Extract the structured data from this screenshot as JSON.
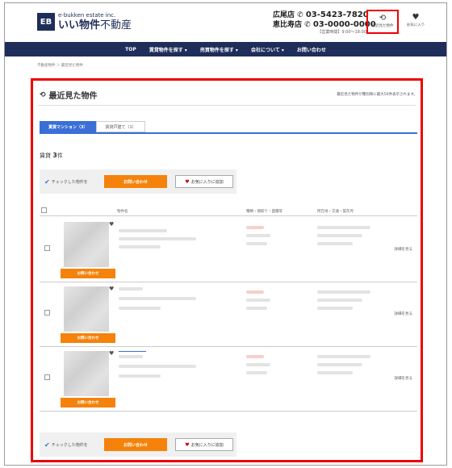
{
  "header": {
    "logo_mark": "EB",
    "logo_sub": "e-bukken estate inc.",
    "logo_main_bold": "いい物件",
    "logo_main_rest": "不動産",
    "contact": [
      {
        "office": "広尾店",
        "phone": "03-5423-7820"
      },
      {
        "office": "恵比寿店",
        "phone": "03-0000-0000"
      }
    ],
    "hours": "【営業時間】9:00～18:00",
    "recent_label": "最近見た物件",
    "favorites_label": "お気に入り"
  },
  "nav": {
    "items": [
      "TOP",
      "賃貸物件を探す ▾",
      "売買物件を探す ▾",
      "会社について ▾",
      "お問い合わせ"
    ]
  },
  "breadcrumb": "不動産物件 ＞ 最近見た物件",
  "main": {
    "title": "最近見た物件",
    "note": "最近見た物件が種別毎に最大50件表示されます。",
    "tabs": [
      {
        "label": "賃貸マンション（3）",
        "active": true
      },
      {
        "label": "賃貸戸建て（1）",
        "active": false
      }
    ],
    "count_prefix": "賃貸",
    "count_value": "3",
    "count_suffix": "件",
    "check_label": "チェックした物件を",
    "inquiry_button": "お問い合わせ",
    "favorite_button": "お気に入りに追加",
    "table_headers": [
      "物件名",
      "種類・間取り・面積等",
      "所在地・交通・築年月"
    ],
    "rows": [
      {
        "inquiry": "お問い合わせ",
        "detail": "詳細を見る"
      },
      {
        "inquiry": "お問い合わせ",
        "detail": "詳細を見る"
      },
      {
        "inquiry": "お問い合わせ",
        "detail": "詳細を見る"
      }
    ]
  },
  "icons": {
    "recent": "history-icon",
    "favorites": "heart-icon",
    "phone": "phone-icon",
    "check": "check-icon"
  },
  "colors": {
    "brand_navy": "#1e2d5a",
    "accent_orange": "#f5820a",
    "tab_blue": "#3a6fd6",
    "highlight_red": "#ee0000"
  }
}
